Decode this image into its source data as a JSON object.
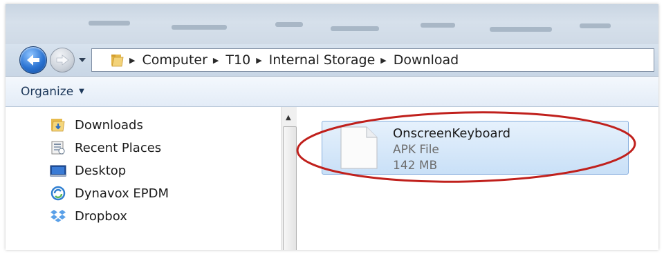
{
  "breadcrumb": [
    "Computer",
    "T10",
    "Internal Storage",
    "Download"
  ],
  "toolbar": {
    "organize_label": "Organize"
  },
  "nav_pane": {
    "items": [
      {
        "label": "Downloads",
        "icon": "downloads-folder-icon"
      },
      {
        "label": "Recent Places",
        "icon": "recent-places-icon"
      },
      {
        "label": "Desktop",
        "icon": "desktop-icon"
      },
      {
        "label": "Dynavox EPDM",
        "icon": "dynavox-icon"
      },
      {
        "label": "Dropbox",
        "icon": "dropbox-icon"
      }
    ]
  },
  "file": {
    "name": "OnscreenKeyboard",
    "type": "APK File",
    "size": "142 MB",
    "icon": "blank-document-icon",
    "selected": true
  },
  "annotation": {
    "shape": "ellipse",
    "color": "#c0201c"
  },
  "colors": {
    "selection_fill": "#c9e0f7",
    "selection_border": "#84acdd",
    "toolbar_text": "#1e395b",
    "back_button": "#2a73d2"
  }
}
